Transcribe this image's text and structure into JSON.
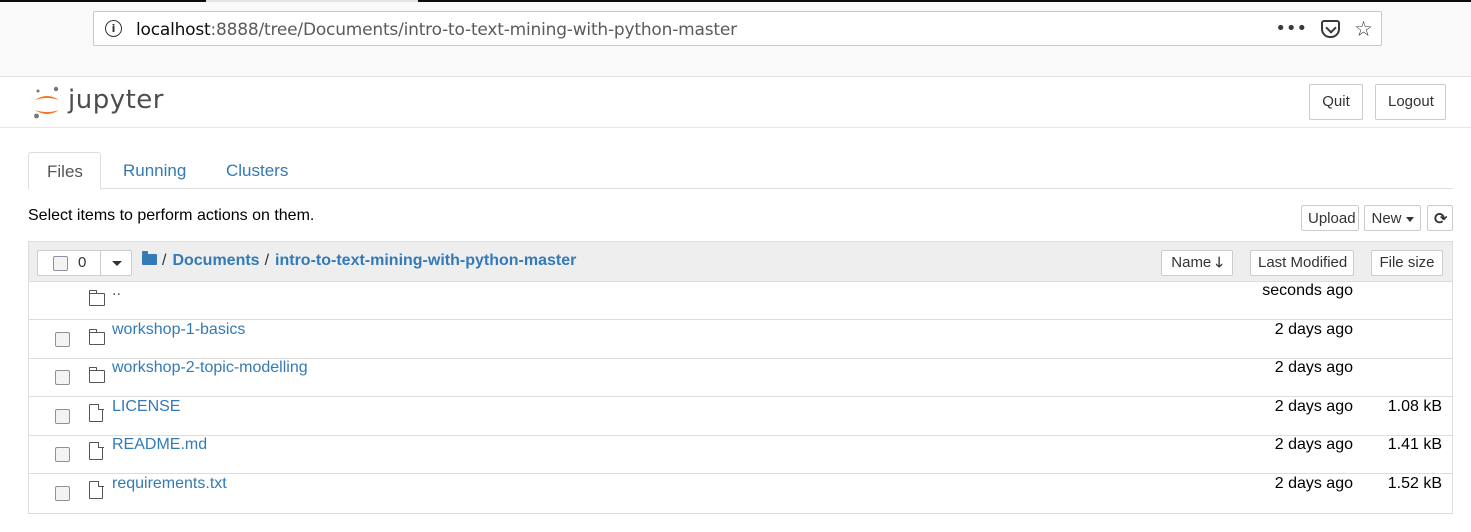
{
  "browser": {
    "url_host": "localhost",
    "url_rest": ":8888/tree/Documents/intro-to-text-mining-with-python-master",
    "info_icon": "info-circle-icon",
    "more_icon": "ellipsis-icon",
    "more_glyph": "•••",
    "pocket_icon": "pocket-icon",
    "bookmark_icon": "star-icon",
    "bookmark_glyph": "☆"
  },
  "header": {
    "logo_text": "jupyter",
    "quit_label": "Quit",
    "logout_label": "Logout"
  },
  "tabs": [
    {
      "label": "Files",
      "active": true
    },
    {
      "label": "Running",
      "active": false
    },
    {
      "label": "Clusters",
      "active": false
    }
  ],
  "toolbar": {
    "hint": "Select items to perform actions on them.",
    "upload_label": "Upload",
    "new_label": "New",
    "refresh_glyph": "⟳"
  },
  "list_header": {
    "selected_count": "0",
    "breadcrumb_sep": "/",
    "breadcrumb": [
      "Documents",
      "intro-to-text-mining-with-python-master"
    ],
    "sort_name_label": "Name",
    "sort_name_arrow": "🡓",
    "sort_modified_label": "Last Modified",
    "sort_size_label": "File size"
  },
  "items": [
    {
      "name": "..",
      "type": "parent",
      "modified": "seconds ago",
      "size": ""
    },
    {
      "name": "workshop-1-basics",
      "type": "folder",
      "modified": "2 days ago",
      "size": ""
    },
    {
      "name": "workshop-2-topic-modelling",
      "type": "folder",
      "modified": "2 days ago",
      "size": ""
    },
    {
      "name": "LICENSE",
      "type": "file",
      "modified": "2 days ago",
      "size": "1.08 kB"
    },
    {
      "name": "README.md",
      "type": "file",
      "modified": "2 days ago",
      "size": "1.41 kB"
    },
    {
      "name": "requirements.txt",
      "type": "file",
      "modified": "2 days ago",
      "size": "1.52 kB"
    }
  ],
  "colors": {
    "link": "#337ab7",
    "logo_orange": "#f37626",
    "logo_gray": "#767677"
  }
}
